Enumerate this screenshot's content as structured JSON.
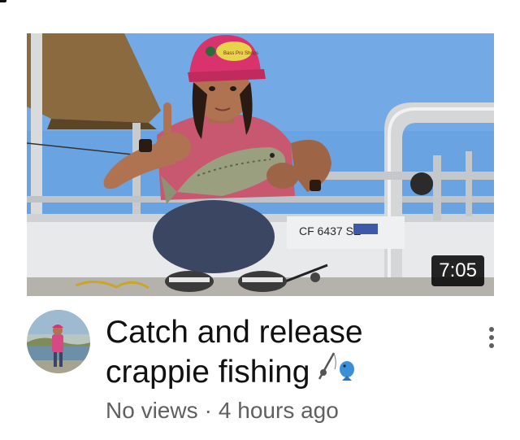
{
  "video": {
    "duration": "7:05",
    "title": "Catch and release crappie fishing",
    "title_emoji_icons": [
      "fishing-pole-icon",
      "fish-icon"
    ],
    "views": "No views",
    "separator": "·",
    "age": "4 hours ago",
    "boat_registration": "CF 6437 SE",
    "cap_text": "Bass Pro Shops"
  },
  "colors": {
    "sky": "#6fa6e3",
    "cap": "#d9336e",
    "duration_bg": "#000000",
    "meta_text": "#606060",
    "title_text": "#111111"
  }
}
